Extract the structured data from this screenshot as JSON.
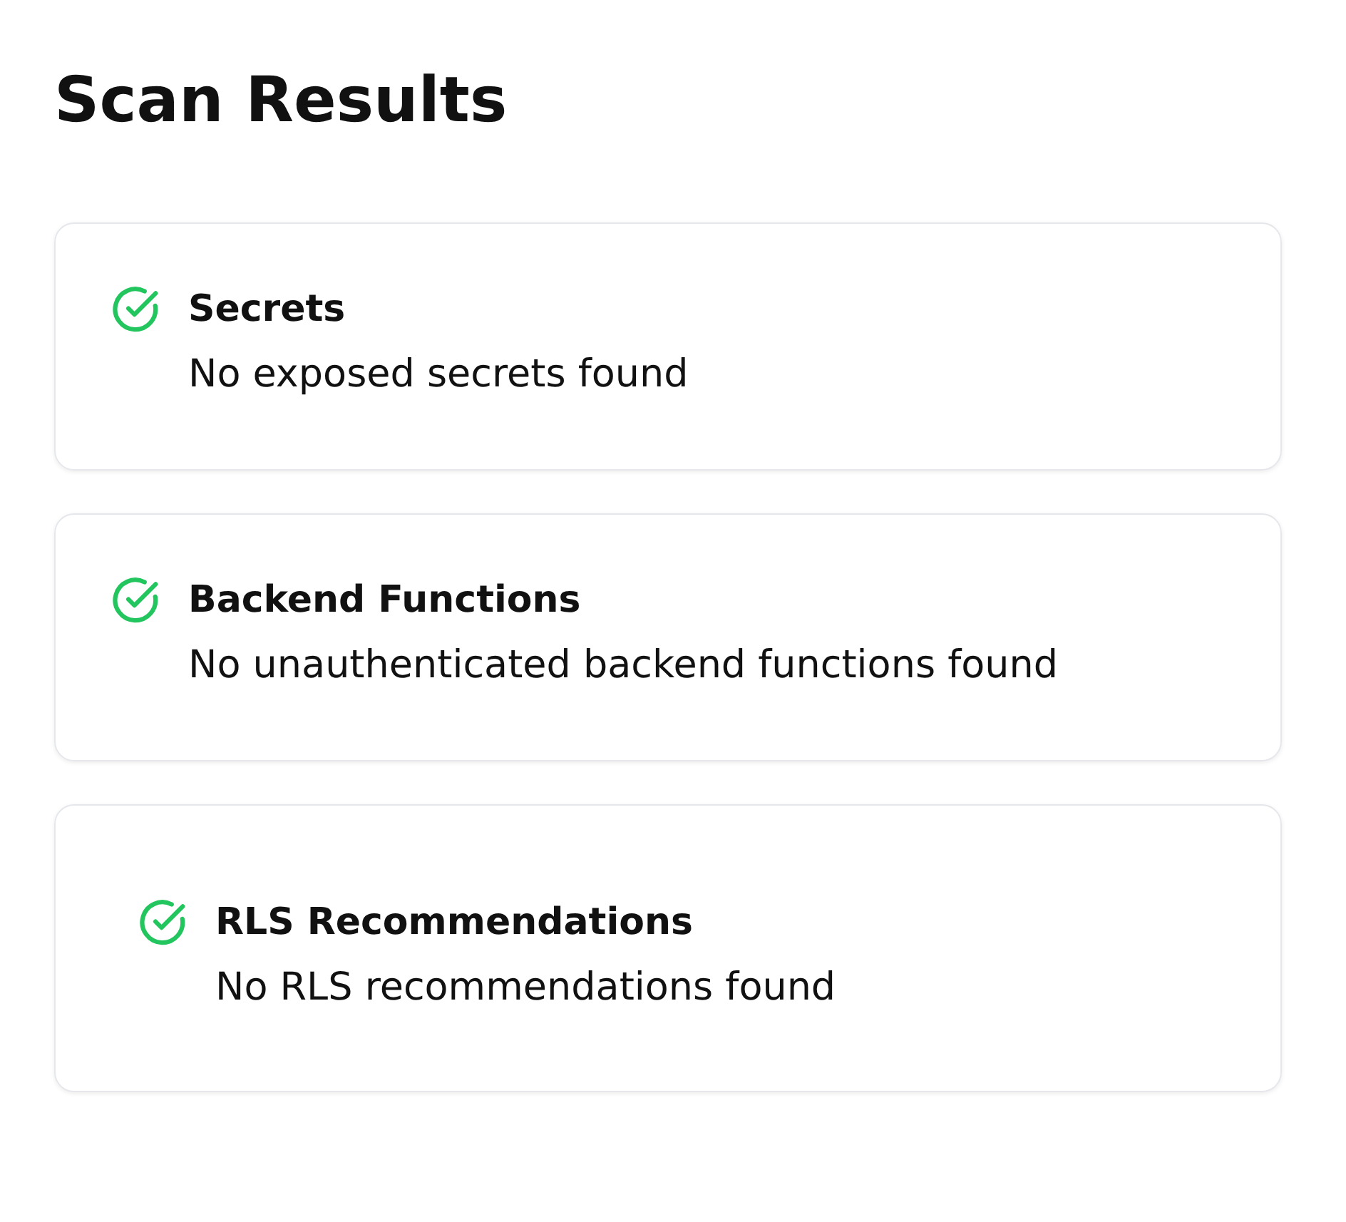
{
  "title": "Scan Results",
  "results": [
    {
      "name": "Secrets",
      "message": "No exposed secrets found",
      "passed": true
    },
    {
      "name": "Backend Functions",
      "message": "No unauthenticated backend functions found",
      "passed": true
    },
    {
      "name": "RLS Recommendations",
      "message": "No RLS recommendations found",
      "passed": true
    }
  ]
}
